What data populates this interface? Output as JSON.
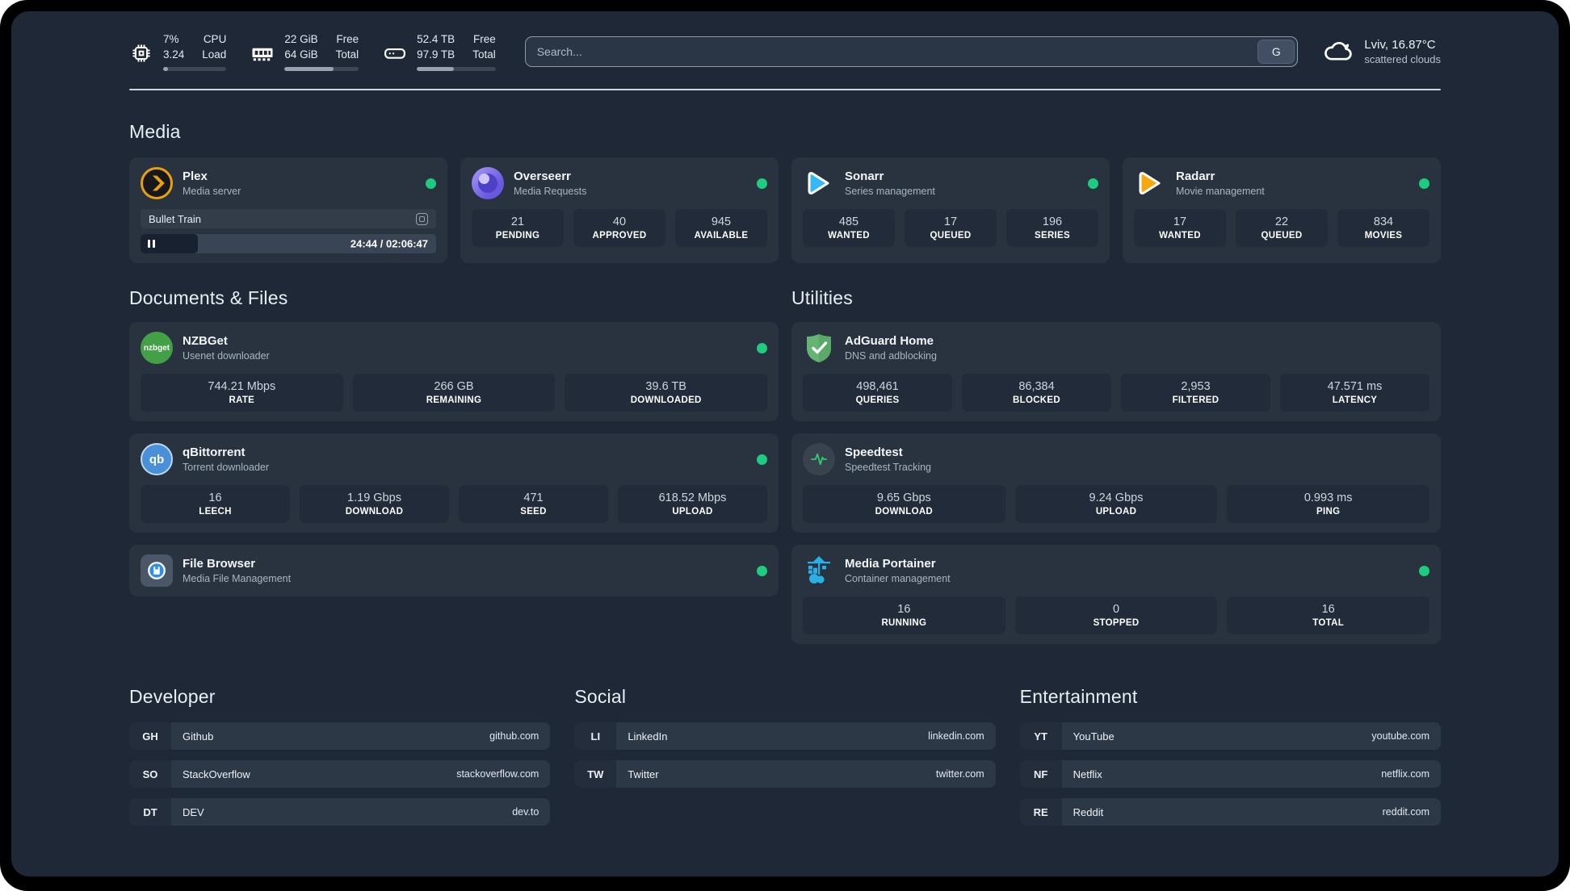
{
  "topbar": {
    "cpu": {
      "usage": "7%",
      "load": "3.24",
      "label_top": "CPU",
      "label_bottom": "Load",
      "bar_percent": 8
    },
    "ram": {
      "free": "22 GiB",
      "total": "64 GiB",
      "label_top": "Free",
      "label_bottom": "Total",
      "bar_percent": 66
    },
    "disk": {
      "free": "52.4 TB",
      "total": "97.9 TB",
      "label_top": "Free",
      "label_bottom": "Total",
      "bar_percent": 47
    },
    "search": {
      "placeholder": "Search...",
      "engine_label": "G"
    },
    "weather": {
      "location": "Lviv, 16.87°C",
      "condition": "scattered clouds"
    }
  },
  "media": {
    "title": "Media",
    "plex": {
      "name": "Plex",
      "desc": "Media server",
      "now_playing": "Bullet Train",
      "time": "24:44 / 02:06:47",
      "progress_percent": 19.5
    },
    "overseerr": {
      "name": "Overseerr",
      "desc": "Media Requests",
      "stats": [
        {
          "value": "21",
          "label": "PENDING"
        },
        {
          "value": "40",
          "label": "APPROVED"
        },
        {
          "value": "945",
          "label": "AVAILABLE"
        }
      ]
    },
    "sonarr": {
      "name": "Sonarr",
      "desc": "Series management",
      "stats": [
        {
          "value": "485",
          "label": "WANTED"
        },
        {
          "value": "17",
          "label": "QUEUED"
        },
        {
          "value": "196",
          "label": "SERIES"
        }
      ]
    },
    "radarr": {
      "name": "Radarr",
      "desc": "Movie management",
      "stats": [
        {
          "value": "17",
          "label": "WANTED"
        },
        {
          "value": "22",
          "label": "QUEUED"
        },
        {
          "value": "834",
          "label": "MOVIES"
        }
      ]
    }
  },
  "documents": {
    "title": "Documents & Files",
    "nzbget": {
      "name": "NZBGet",
      "desc": "Usenet downloader",
      "icon_text": "nzbget",
      "stats": [
        {
          "value": "744.21 Mbps",
          "label": "RATE"
        },
        {
          "value": "266 GB",
          "label": "REMAINING"
        },
        {
          "value": "39.6 TB",
          "label": "DOWNLOADED"
        }
      ]
    },
    "qbittorrent": {
      "name": "qBittorrent",
      "desc": "Torrent downloader",
      "icon_text": "qb",
      "stats": [
        {
          "value": "16",
          "label": "LEECH"
        },
        {
          "value": "1.19 Gbps",
          "label": "DOWNLOAD"
        },
        {
          "value": "471",
          "label": "SEED"
        },
        {
          "value": "618.52 Mbps",
          "label": "UPLOAD"
        }
      ]
    },
    "filebrowser": {
      "name": "File Browser",
      "desc": "Media File Management"
    }
  },
  "utilities": {
    "title": "Utilities",
    "adguard": {
      "name": "AdGuard Home",
      "desc": "DNS and adblocking",
      "stats": [
        {
          "value": "498,461",
          "label": "QUERIES"
        },
        {
          "value": "86,384",
          "label": "BLOCKED"
        },
        {
          "value": "2,953",
          "label": "FILTERED"
        },
        {
          "value": "47.571 ms",
          "label": "LATENCY"
        }
      ]
    },
    "speedtest": {
      "name": "Speedtest",
      "desc": "Speedtest Tracking",
      "stats": [
        {
          "value": "9.65 Gbps",
          "label": "DOWNLOAD"
        },
        {
          "value": "9.24 Gbps",
          "label": "UPLOAD"
        },
        {
          "value": "0.993 ms",
          "label": "PING"
        }
      ]
    },
    "portainer": {
      "name": "Media Portainer",
      "desc": "Container management",
      "stats": [
        {
          "value": "16",
          "label": "RUNNING"
        },
        {
          "value": "0",
          "label": "STOPPED"
        },
        {
          "value": "16",
          "label": "TOTAL"
        }
      ]
    }
  },
  "links": {
    "developer": {
      "title": "Developer",
      "items": [
        {
          "prefix": "GH",
          "name": "Github",
          "url": "github.com"
        },
        {
          "prefix": "SO",
          "name": "StackOverflow",
          "url": "stackoverflow.com"
        },
        {
          "prefix": "DT",
          "name": "DEV",
          "url": "dev.to"
        }
      ]
    },
    "social": {
      "title": "Social",
      "items": [
        {
          "prefix": "LI",
          "name": "LinkedIn",
          "url": "linkedin.com"
        },
        {
          "prefix": "TW",
          "name": "Twitter",
          "url": "twitter.com"
        }
      ]
    },
    "entertainment": {
      "title": "Entertainment",
      "items": [
        {
          "prefix": "YT",
          "name": "YouTube",
          "url": "youtube.com"
        },
        {
          "prefix": "NF",
          "name": "Netflix",
          "url": "netflix.com"
        },
        {
          "prefix": "RE",
          "name": "Reddit",
          "url": "reddit.com"
        }
      ]
    }
  },
  "colors": {
    "status_online": "#1ecb81",
    "accent_amber": "#e8a10c",
    "accent_blue": "#35b8f5"
  }
}
